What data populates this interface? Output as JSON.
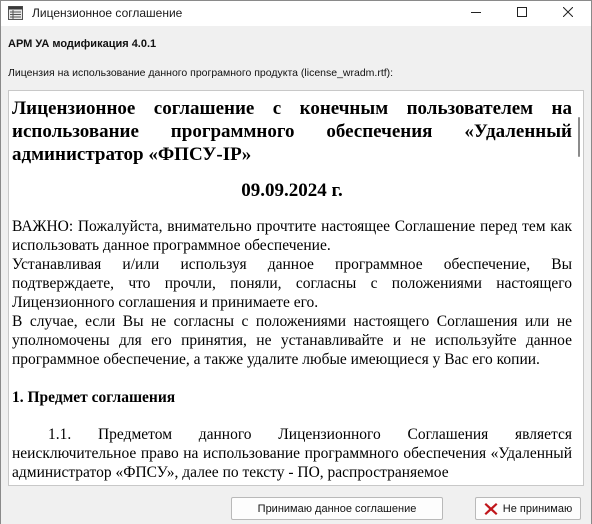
{
  "window": {
    "title": "Лицензионное соглашение"
  },
  "app": {
    "heading": "АРМ УА модификация 4.0.1",
    "license_caption": "Лицензия на использование данного програмного продукта (license_wradm.rtf):"
  },
  "document": {
    "title": "Лицензионное соглашение с конечным пользователем на использование программного обеспечения «Удаленный администратор «ФПСУ-IP»",
    "date": "09.09.2024 г.",
    "paragraphs": [
      "ВАЖНО: Пожалуйста, внимательно прочтите настоящее Соглашение перед тем как использовать данное программное обеспечение.",
      "Устанавливая и/или используя данное программное обеспечение, Вы подтверждаете, что прочли, поняли, согласны с положениями настоящего Лицензионного соглашения и принимаете его.",
      "В случае, если Вы не согласны с положениями настоящего Соглашения или не уполномочены для его принятия, не устанавливайте и не используйте данное программное обеспечение, а также удалите любые имеющиеся у Вас его копии."
    ],
    "section1_heading": "1. Предмет соглашения",
    "section1_text": "1.1. Предметом данного Лицензионного Соглашения является неисключительное право на использование программного обеспечения «Удаленный администратор «ФПСУ», далее по тексту - ПО, распространяемое"
  },
  "buttons": {
    "accept_label": "Принимаю данное соглашение",
    "decline_label": "Не принимаю"
  },
  "icons": {
    "app": "app-window-icon",
    "minimize": "minimize-icon",
    "maximize": "maximize-icon",
    "close": "close-icon",
    "decline": "red-x-icon"
  },
  "colors": {
    "decline_icon": "#c0161b"
  }
}
